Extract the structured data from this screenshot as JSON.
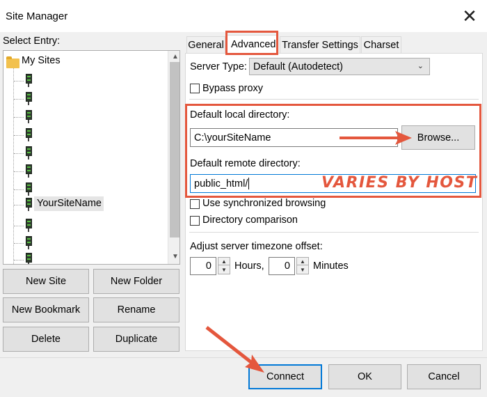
{
  "window": {
    "title": "Site Manager",
    "close_glyph": "✕"
  },
  "entry": {
    "label": "Select Entry:",
    "root_label": "My Sites",
    "selected_site": "YourSiteName"
  },
  "left_buttons": {
    "new_site": "New Site",
    "new_folder": "New Folder",
    "new_bookmark": "New Bookmark",
    "rename": "Rename",
    "delete": "Delete",
    "duplicate": "Duplicate"
  },
  "tabs": [
    "General",
    "Advanced",
    "Transfer Settings",
    "Charset"
  ],
  "active_tab": "Advanced",
  "advanced": {
    "server_type_label": "Server Type:",
    "server_type_value": "Default (Autodetect)",
    "bypass_proxy": "Bypass proxy",
    "local_dir_label": "Default local directory:",
    "local_dir_value": "C:\\yourSiteName",
    "browse": "Browse...",
    "remote_dir_label": "Default remote directory:",
    "remote_dir_value": "public_html/",
    "sync_browsing": "Use synchronized browsing",
    "dir_comparison": "Directory comparison",
    "timezone_label": "Adjust server timezone offset:",
    "hours_value": "0",
    "hours_label": "Hours,",
    "minutes_value": "0",
    "minutes_label": "Minutes"
  },
  "annotation": {
    "note": "VARIES BY HOST",
    "color": "#e4573d"
  },
  "footer": {
    "connect": "Connect",
    "ok": "OK",
    "cancel": "Cancel"
  },
  "icons": [
    "close-icon",
    "folder-icon",
    "server-icon",
    "chevron-down-icon",
    "arrow-up-icon",
    "arrow-down-icon"
  ]
}
